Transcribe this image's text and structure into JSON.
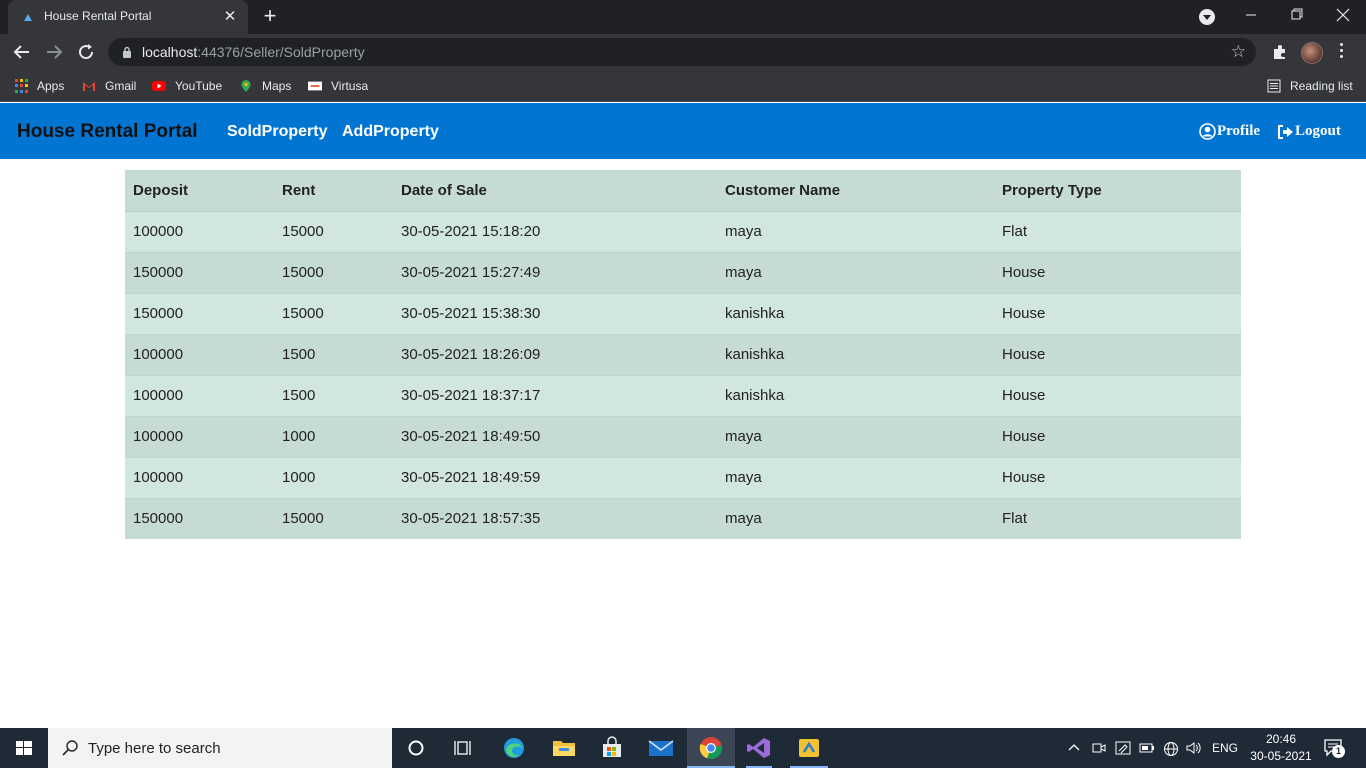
{
  "browser": {
    "tab_title": "House Rental Portal",
    "url_host": "localhost",
    "url_rest": ":44376/Seller/SoldProperty",
    "bookmarks": [
      "Apps",
      "Gmail",
      "YouTube",
      "Maps",
      "Virtusa"
    ],
    "reading_list": "Reading list"
  },
  "navbar": {
    "brand": "House Rental Portal",
    "links": [
      "SoldProperty",
      "AddProperty"
    ],
    "profile": "Profile",
    "logout": "Logout",
    "bg_color": "#0275d2"
  },
  "table": {
    "headers": [
      "Deposit",
      "Rent",
      "Date of Sale",
      "Customer Name",
      "Property Type"
    ],
    "rows": [
      [
        "100000",
        "15000",
        "30-05-2021 15:18:20",
        "maya",
        "Flat"
      ],
      [
        "150000",
        "15000",
        "30-05-2021 15:27:49",
        "maya",
        "House"
      ],
      [
        "150000",
        "15000",
        "30-05-2021 15:38:30",
        "kanishka",
        "House"
      ],
      [
        "100000",
        "1500",
        "30-05-2021 18:26:09",
        "kanishka",
        "House"
      ],
      [
        "100000",
        "1500",
        "30-05-2021 18:37:17",
        "kanishka",
        "House"
      ],
      [
        "100000",
        "1000",
        "30-05-2021 18:49:50",
        "maya",
        "House"
      ],
      [
        "100000",
        "1000",
        "30-05-2021 18:49:59",
        "maya",
        "House"
      ],
      [
        "150000",
        "15000",
        "30-05-2021 18:57:35",
        "maya",
        "Flat"
      ]
    ]
  },
  "taskbar": {
    "search_placeholder": "Type here to search",
    "language": "ENG",
    "time": "20:46",
    "date": "30-05-2021",
    "notification_count": "1"
  }
}
